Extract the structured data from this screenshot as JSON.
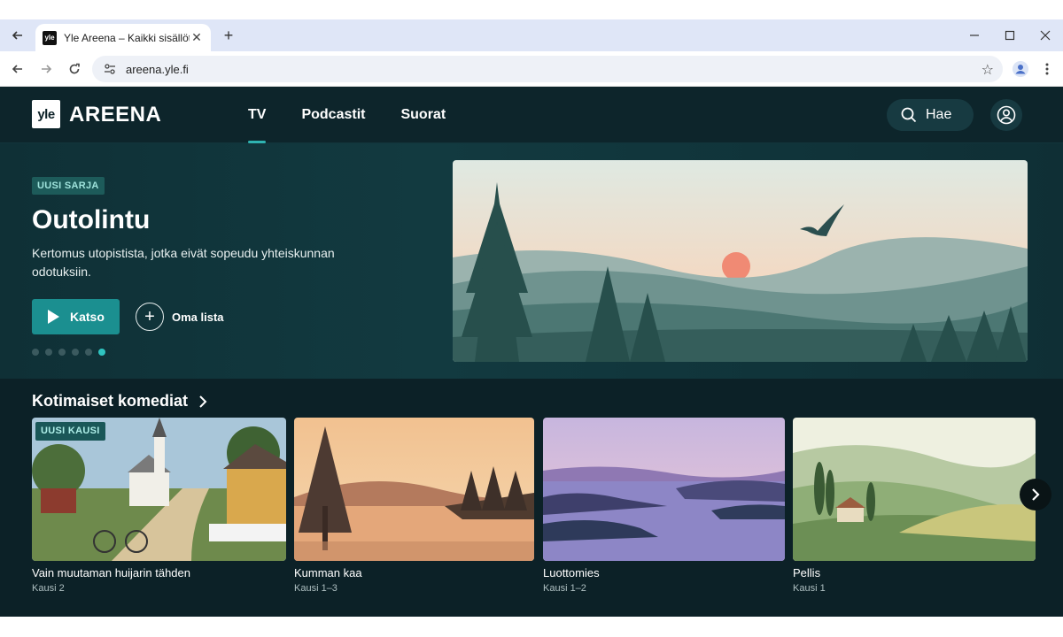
{
  "browser": {
    "tab_title": "Yle Areena – Kaikki sisällöt",
    "favicon_text": "yle",
    "url": "areena.yle.fi"
  },
  "site": {
    "logo_mark": "yle",
    "logo_text": "AREENA",
    "nav": [
      {
        "label": "TV",
        "active": true
      },
      {
        "label": "Podcastit",
        "active": false
      },
      {
        "label": "Suorat",
        "active": false
      }
    ],
    "search_label": "Hae"
  },
  "hero": {
    "badge": "UUSI SARJA",
    "title": "Outolintu",
    "description": "Kertomus utopistista, jotka eivät sopeudu yhteiskunnan odotuksiin.",
    "watch_label": "Katso",
    "mylist_label": "Oma lista",
    "slides_total": 6,
    "slide_active": 6
  },
  "row": {
    "title": "Kotimaiset komediat",
    "cards": [
      {
        "title": "Vain muutaman huijarin tähden",
        "subtitle": "Kausi 2",
        "badge": "UUSI KAUSI"
      },
      {
        "title": "Kumman kaa",
        "subtitle": "Kausi 1–3"
      },
      {
        "title": "Luottomies",
        "subtitle": "Kausi 1–2"
      },
      {
        "title": "Pellis",
        "subtitle": "Kausi 1"
      }
    ]
  },
  "colors": {
    "accent": "#2fb3b1",
    "watch_button": "#1b8f90",
    "background": "#0c2127"
  }
}
